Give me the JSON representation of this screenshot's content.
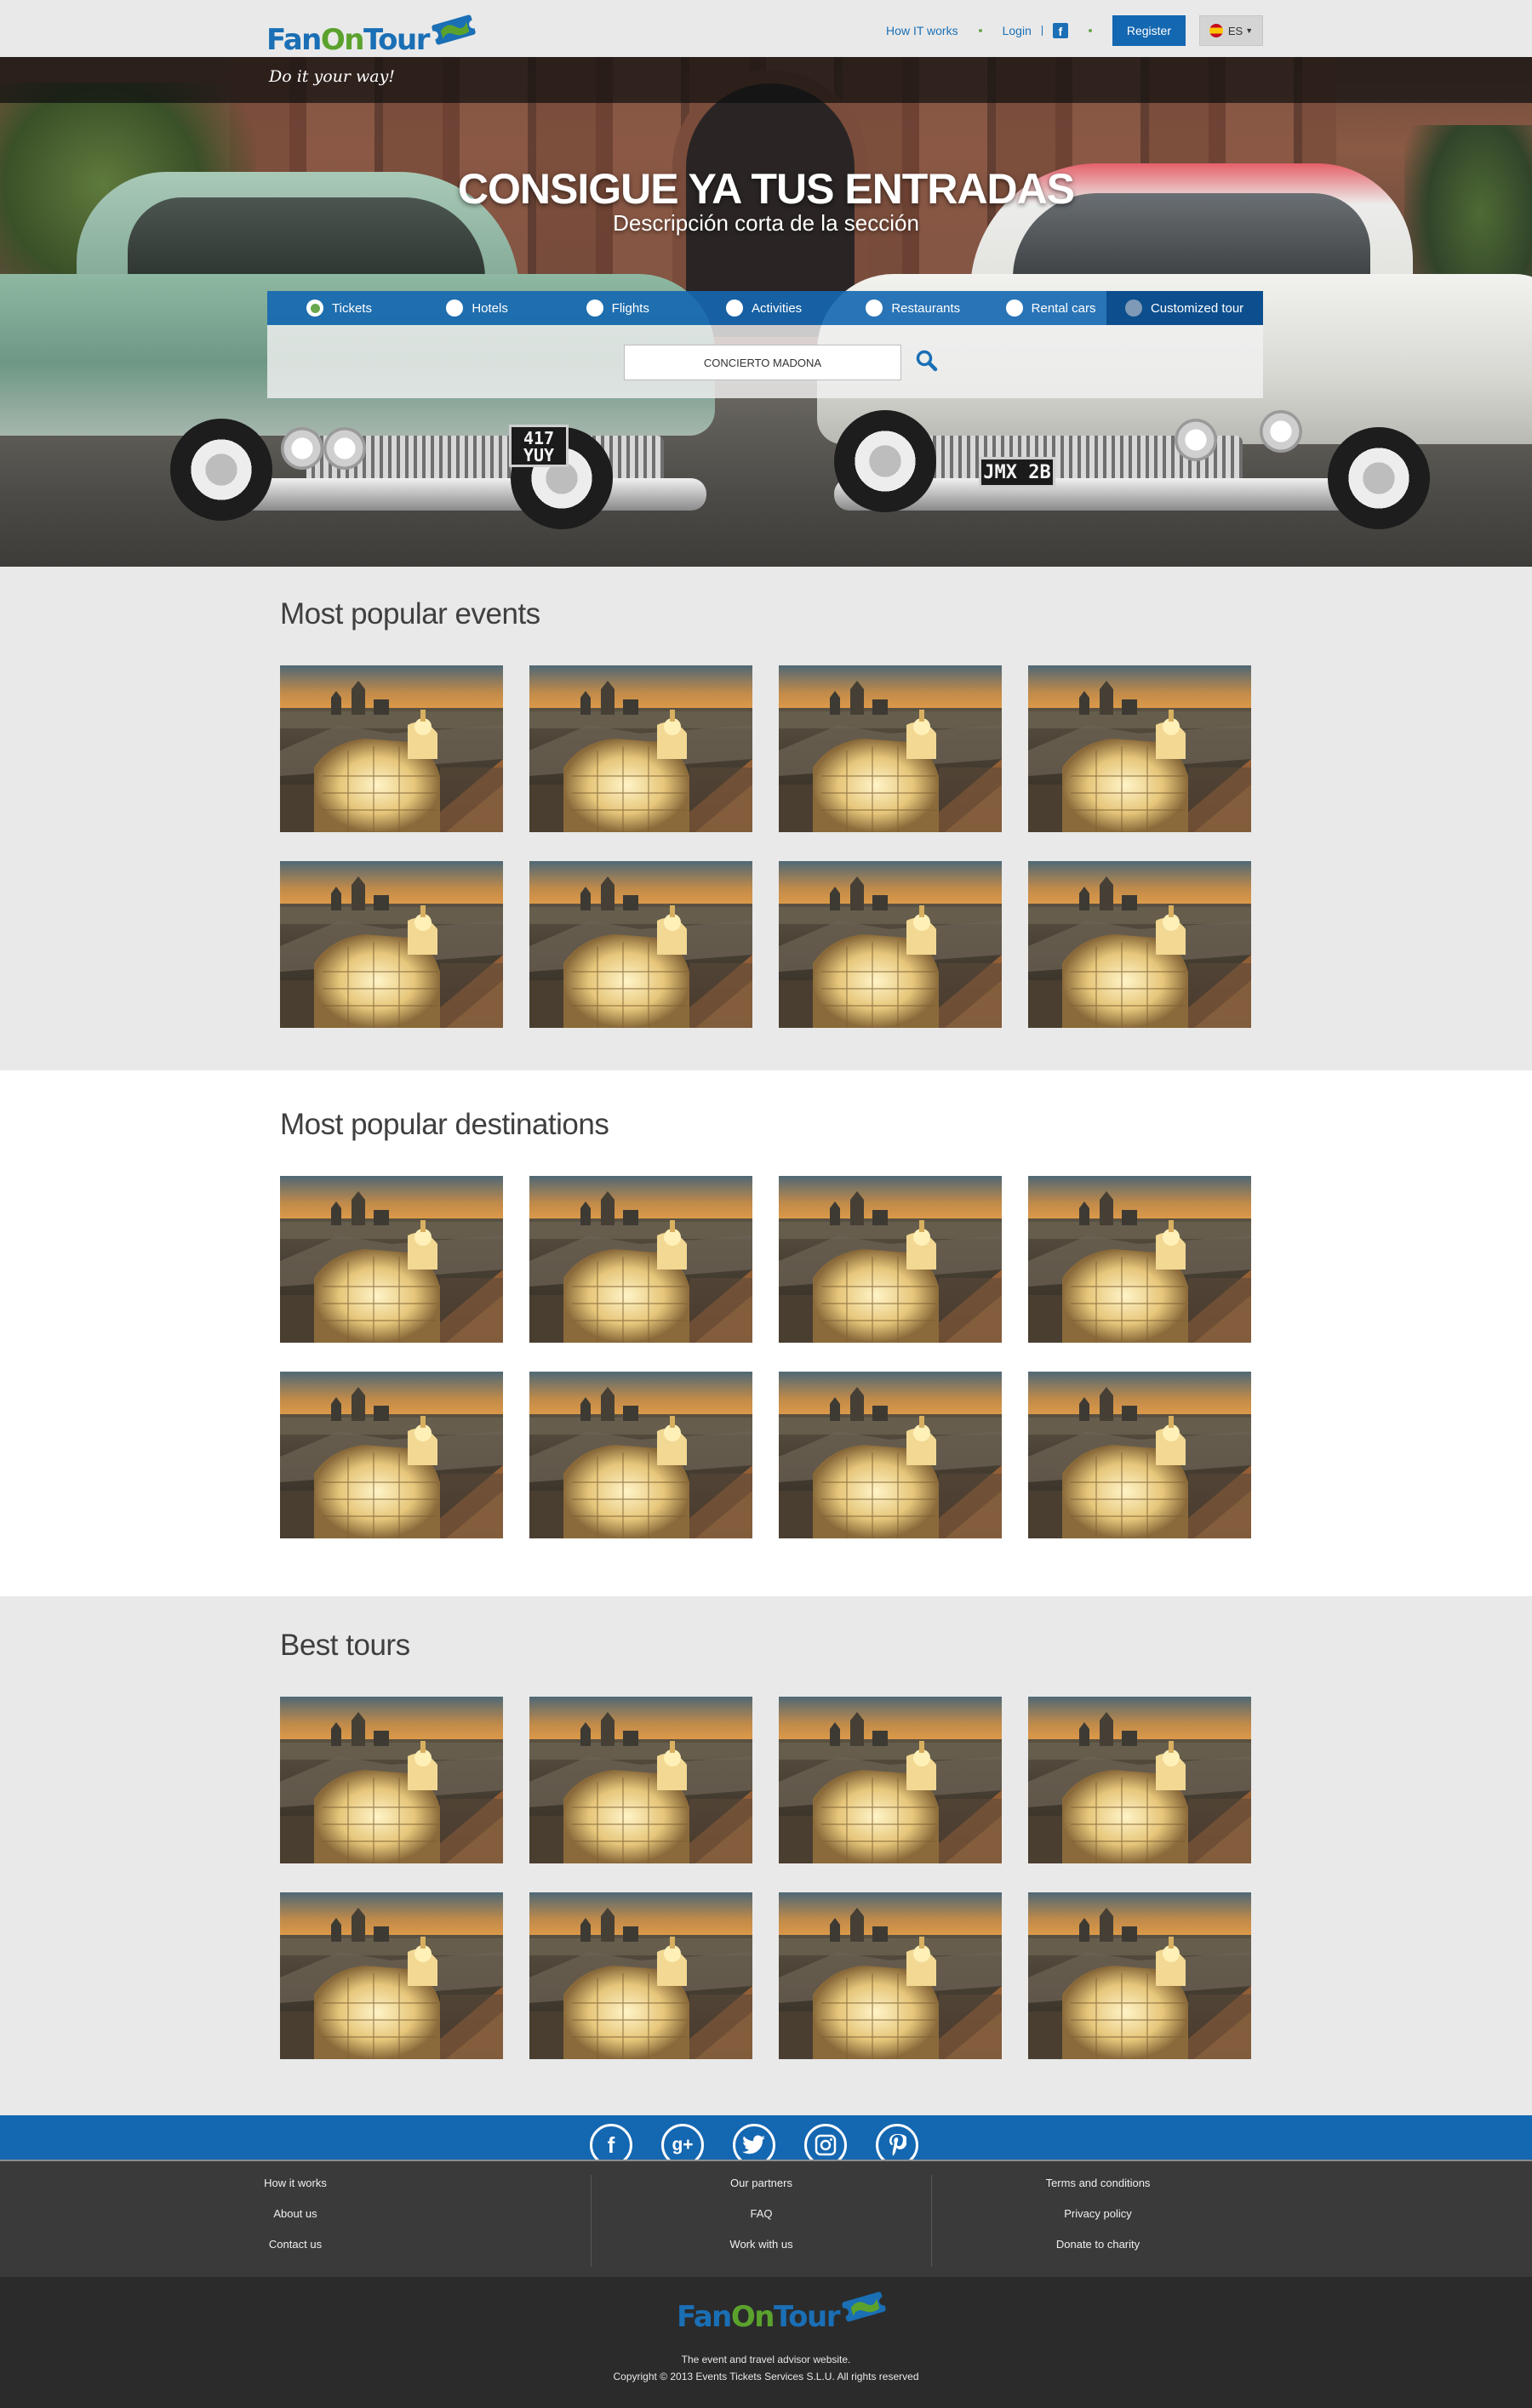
{
  "brand": {
    "logo_fan": "Fan",
    "logo_on": "On",
    "logo_tour": "Tour",
    "tagline": "Do it your way!",
    "brand_blue": "#1a6fb5",
    "brand_green": "#5ba22d"
  },
  "nav": {
    "how_it_works": "How IT works",
    "login": "Login",
    "facebook_icon": "facebook-icon",
    "register": "Register",
    "language": "ES"
  },
  "hero": {
    "title": "CONSIGUE YA TUS ENTRADAS",
    "subtitle": "Descripción corta de la sección",
    "plate_left": "417 YUY",
    "plate_right": "JMX 2B"
  },
  "search": {
    "tabs": [
      {
        "label": "Tickets",
        "selected": true
      },
      {
        "label": "Hotels",
        "selected": false
      },
      {
        "label": "Flights",
        "selected": false
      },
      {
        "label": "Activities",
        "selected": false
      },
      {
        "label": "Restaurants",
        "selected": false
      },
      {
        "label": "Rental cars",
        "selected": false
      },
      {
        "label": "Customized tour",
        "selected": false
      }
    ],
    "query": "CONCIERTO MADONA",
    "search_icon": "search-icon"
  },
  "sections": {
    "events": {
      "title": "Most popular events"
    },
    "destinations": {
      "title": "Most popular destinations"
    },
    "tours": {
      "title": "Best tours"
    }
  },
  "social": {
    "icons": [
      "facebook-icon",
      "google-plus-icon",
      "twitter-icon",
      "instagram-icon",
      "pinterest-icon"
    ],
    "labels": {
      "google_plus": "g+"
    }
  },
  "footer": {
    "col1": [
      "How it works",
      "About us",
      "Contact us"
    ],
    "col2": [
      "Our partners",
      "FAQ",
      "Work with us"
    ],
    "col3": [
      "Terms and conditions",
      "Privacy policy",
      "Donate to charity"
    ],
    "tagline": "The event and travel advisor website.",
    "copyright": "Copyright © 2013 Events Tickets Services S.L.U. All rights reserved"
  }
}
